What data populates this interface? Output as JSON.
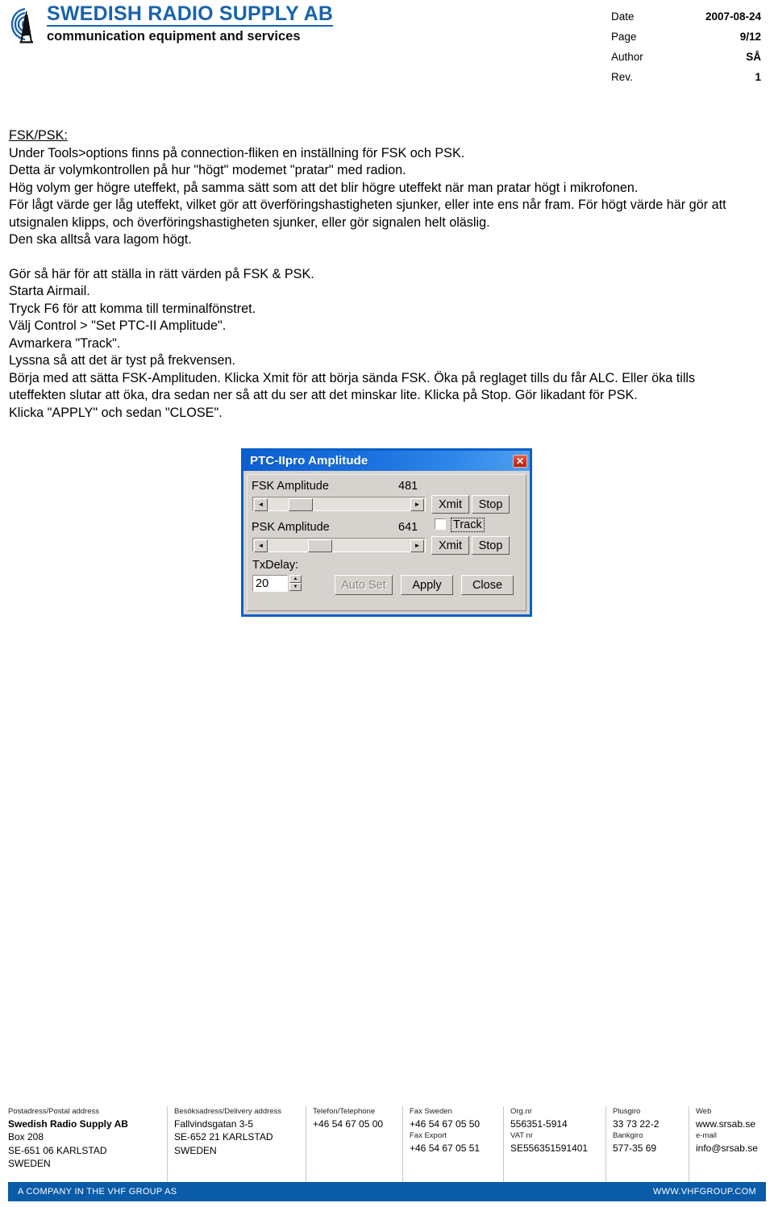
{
  "header": {
    "logo": {
      "icon": "radio-tower-icon",
      "line1": "SWEDISH RADIO SUPPLY AB",
      "line2": "communication equipment and services",
      "brand_color": "#1963ad"
    },
    "meta": [
      {
        "label": "Date",
        "value": "2007-08-24"
      },
      {
        "label": "Page",
        "value": "9/12"
      },
      {
        "label": "Author",
        "value": "SÅ"
      },
      {
        "label": "Rev.",
        "value": "1"
      }
    ]
  },
  "content": {
    "heading": "FSK/PSK:",
    "block1": [
      "Under Tools>options finns på connection-fliken en inställning för FSK och PSK.",
      "Detta är volymkontrollen på hur \"högt\" modemet \"pratar\" med radion.",
      "Hög volym ger högre uteffekt, på samma sätt som att det blir högre uteffekt när man pratar högt i mikrofonen.",
      "För lågt värde ger låg uteffekt, vilket gör att överföringshastigheten sjunker, eller inte ens når fram. För högt värde här gör att utsignalen klipps, och överföringshastigheten sjunker, eller gör signalen helt oläslig.",
      "Den ska alltså vara lagom högt."
    ],
    "block2": [
      "Gör så här för att ställa in rätt värden på FSK & PSK.",
      "Starta Airmail.",
      "Tryck F6 för att komma till terminalfönstret.",
      "Välj Control > \"Set PTC-II Amplitude\".",
      "Avmarkera \"Track\".",
      "Lyssna så att det är tyst på frekvensen.",
      "Börja med att sätta FSK-Amplituden. Klicka Xmit för att börja sända FSK. Öka på reglaget tills du får ALC. Eller öka tills uteffekten slutar att öka, dra sedan ner så att du ser att det minskar lite. Klicka på Stop. Gör likadant för PSK.",
      "Klicka \"APPLY\" och sedan \"CLOSE\"."
    ]
  },
  "dialog": {
    "title": "PTC-IIpro Amplitude",
    "close_label": "✕",
    "titlebar_color": "#0b5fd0",
    "fsk": {
      "label": "FSK Amplitude",
      "value": "481",
      "left_arrow": "◄",
      "right_arrow": "►",
      "xmit": "Xmit",
      "stop": "Stop"
    },
    "psk": {
      "label": "PSK Amplitude",
      "value": "641",
      "left_arrow": "◄",
      "right_arrow": "►",
      "xmit": "Xmit",
      "stop": "Stop"
    },
    "track": {
      "label": "Track",
      "checked": false
    },
    "txdelay": {
      "label": "TxDelay:",
      "value": "20",
      "up_arrow": "▲",
      "down_arrow": "▼"
    },
    "buttons": {
      "auto_set": "Auto Set",
      "apply": "Apply",
      "close": "Close"
    }
  },
  "footer": {
    "columns": [
      {
        "lines": [
          {
            "text": "Postadress/Postal address",
            "type": "lbl"
          },
          {
            "text": "Swedish Radio Supply AB",
            "type": "val bold"
          },
          {
            "text": "Box 208",
            "type": "val"
          },
          {
            "text": "SE-651 06  KARLSTAD",
            "type": "val"
          },
          {
            "text": "SWEDEN",
            "type": "val"
          }
        ]
      },
      {
        "lines": [
          {
            "text": "Besöksadress/Delivery address",
            "type": "lbl"
          },
          {
            "text": "Fallvindsgatan 3-5",
            "type": "val"
          },
          {
            "text": "SE-652 21  KARLSTAD",
            "type": "val"
          },
          {
            "text": "SWEDEN",
            "type": "val"
          }
        ]
      },
      {
        "lines": [
          {
            "text": "Telefon/Telephone",
            "type": "lbl"
          },
          {
            "text": "+46 54 67 05 00",
            "type": "val"
          }
        ]
      },
      {
        "lines": [
          {
            "text": "Fax Sweden",
            "type": "lbl"
          },
          {
            "text": "+46 54 67 05 50",
            "type": "val"
          },
          {
            "text": "Fax Export",
            "type": "lbl"
          },
          {
            "text": "+46 54 67 05 51",
            "type": "val"
          }
        ]
      },
      {
        "lines": [
          {
            "text": "Org.nr",
            "type": "lbl"
          },
          {
            "text": "556351-5914",
            "type": "val"
          },
          {
            "text": "VAT nr",
            "type": "lbl"
          },
          {
            "text": "SE556351591401",
            "type": "val"
          }
        ]
      },
      {
        "lines": [
          {
            "text": "Plusgiro",
            "type": "lbl"
          },
          {
            "text": "33 73 22-2",
            "type": "val"
          },
          {
            "text": "Bankgiro",
            "type": "lbl"
          },
          {
            "text": "577-35 69",
            "type": "val"
          }
        ]
      },
      {
        "lines": [
          {
            "text": "Web",
            "type": "lbl"
          },
          {
            "text": "www.srsab.se",
            "type": "val"
          },
          {
            "text": "e-mail",
            "type": "lbl"
          },
          {
            "text": "info@srsab.se",
            "type": "val"
          }
        ]
      }
    ],
    "bar": {
      "left": "A COMPANY IN THE VHF GROUP AS",
      "right": "WWW.VHFGROUP.COM",
      "color": "#0a5ba8"
    }
  }
}
